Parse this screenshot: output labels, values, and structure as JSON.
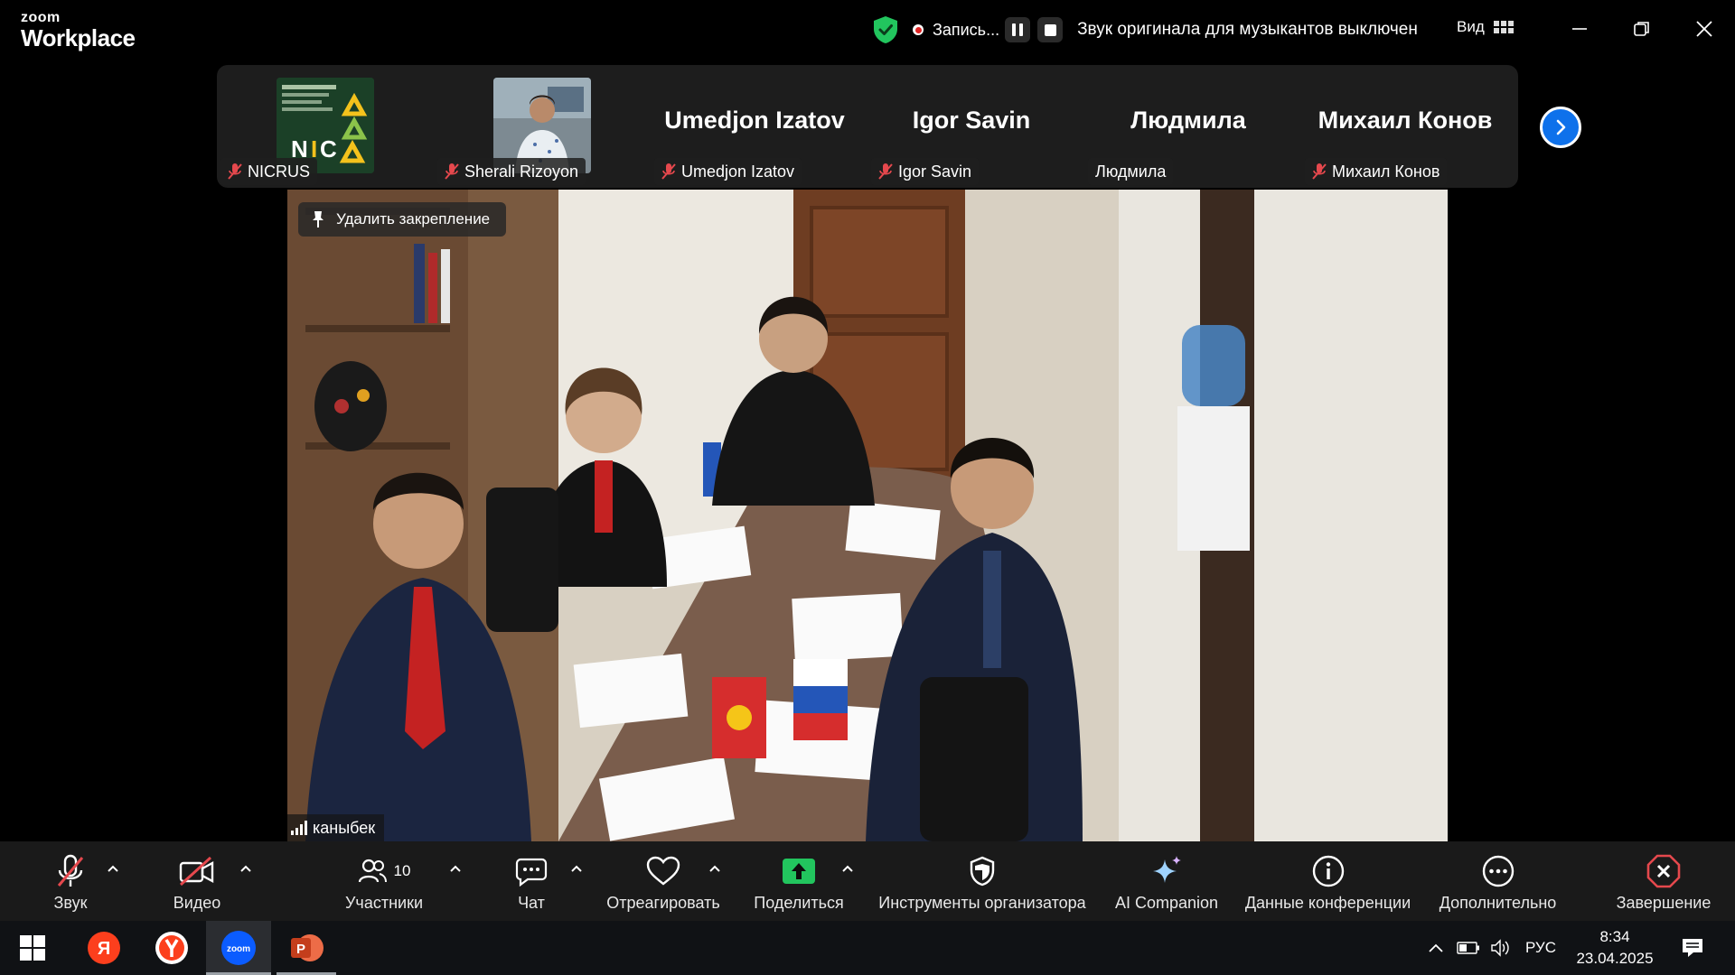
{
  "app": {
    "logo_top": "zoom",
    "logo_bottom": "Workplace"
  },
  "titlebar": {
    "recording_label": "Запись...",
    "original_sound_status": "Звук оригинала для музыкантов выключен",
    "view_label": "Вид"
  },
  "participants": [
    {
      "name": "NICRUS",
      "display": "",
      "muted": true,
      "has_video": true
    },
    {
      "name": "Sherali Rizoyon",
      "display": "",
      "muted": true,
      "has_video": true
    },
    {
      "name": "Umedjon Izatov",
      "display": "Umedjon Izatov",
      "muted": true,
      "has_video": false
    },
    {
      "name": "Igor Savin",
      "display": "Igor Savin",
      "muted": true,
      "has_video": false
    },
    {
      "name": "Людмила",
      "display": "Людмила",
      "muted": false,
      "has_video": false
    },
    {
      "name": "Михаил Конов",
      "display": "Михаил Конов",
      "muted": true,
      "has_video": false
    }
  ],
  "nicrus_logo_text": "НАЦИОНАЛЬНЫЙ ИССЛЕДОВАТЕЛЬСКИЙ ИНСТИТУТ РАЗВИТИЯ КОММУНИКАЦИЙ",
  "main_video": {
    "unpin_label": "Удалить закрепление",
    "speaker_name": "каныбек"
  },
  "toolbar": {
    "audio": "Звук",
    "video": "Видео",
    "participants": "Участники",
    "participants_count": "10",
    "chat": "Чат",
    "react": "Отреагировать",
    "share": "Поделиться",
    "host_tools": "Инструменты организатора",
    "ai_companion": "AI Companion",
    "meeting_info": "Данные конференции",
    "more": "Дополнительно",
    "end": "Завершение"
  },
  "taskbar": {
    "language": "РУС",
    "time": "8:34",
    "date": "23.04.2025",
    "zoom_icon_text": "zoom",
    "yandex_letter": "Я",
    "ppt_letter": "P"
  },
  "colors": {
    "accent_blue": "#0e71eb",
    "share_green": "#22c55e",
    "end_red": "#e5484d",
    "shield_green": "#22c55e",
    "mute_red": "#e5484d"
  }
}
